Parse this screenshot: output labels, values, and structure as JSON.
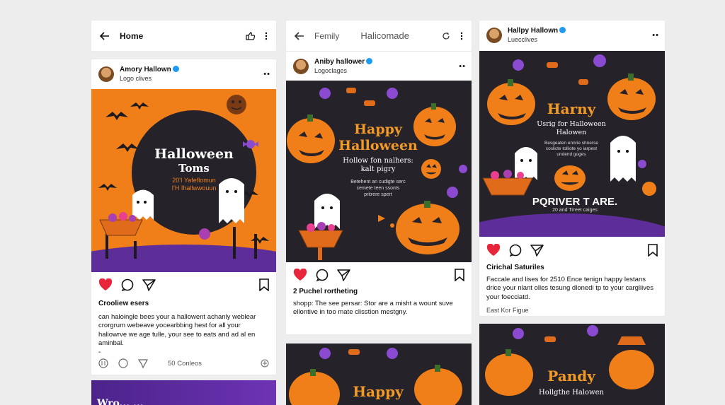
{
  "colors": {
    "orange": "#f07f1a",
    "dark": "#252229",
    "purple": "#5d2d9a",
    "heart": "#e8253a"
  },
  "col1": {
    "topbar": {
      "back_icon": "arrow-left-icon",
      "title": "Home",
      "icons": [
        "like-icon",
        "more-vert-icon"
      ]
    },
    "post": {
      "author": "Amory Hallown",
      "subtitle": "Logo clives",
      "image": {
        "title": "Halloween",
        "title2": "Toms",
        "line1": "20'I Yafeflomun",
        "line2": "I'H Ihallwwouun"
      },
      "likes": "Crooliew esers",
      "caption": "can haloingle bees your a hallowent achanly weblear crorgrum webeave yocearbbing hest for all your haliowrve we age tulle, your see to eats and ad al en aminbal.",
      "bottom_count": "50 Conleos"
    },
    "next_banner": "Wro... ..."
  },
  "col2": {
    "topbar": {
      "title": "Femily",
      "center": "Halicomade"
    },
    "post": {
      "author": "Aniby hallower",
      "subtitle": "Logoclages",
      "image": {
        "h1": "Happy",
        "h2": "Halloween",
        "line1": "Hollow fon nalhers:",
        "line2": "kalt pigry",
        "small1": "Betehent an cudigte serc",
        "small2": "cemete teen ssonts",
        "small3": "pritrere spert"
      },
      "likes": "2 Puchel rortheting",
      "caption": "shopp: The see persar: Stor are a misht a wount suve ellontive in too mate clisstion mestgny."
    },
    "next": {
      "h1": "Happy"
    }
  },
  "col3": {
    "post": {
      "author": "Hallpy Hallown",
      "subtitle": "Luecclives",
      "image": {
        "h1": "Harny",
        "line1": "Usrig for Halloween",
        "line2": "Halowen",
        "small1": "Besgeaten ennrie shnerse",
        "small2": "coslicte tolliote yo iarpest",
        "small3": "undend goges",
        "banner": "PQRIVER T ARE.",
        "banner_sub": "20 and Trreet caiges"
      },
      "likes": "Cirichal Saturiles",
      "caption": "Faccale and lises for 2510 Ence tenign happy lestans drice your nlant olles tesung dlonedi tp to your cargliives your foecciatd.",
      "footer": "East Kor Figue"
    },
    "next": {
      "h1": "Pandy",
      "line1": "Hollgthe Halowen"
    }
  }
}
